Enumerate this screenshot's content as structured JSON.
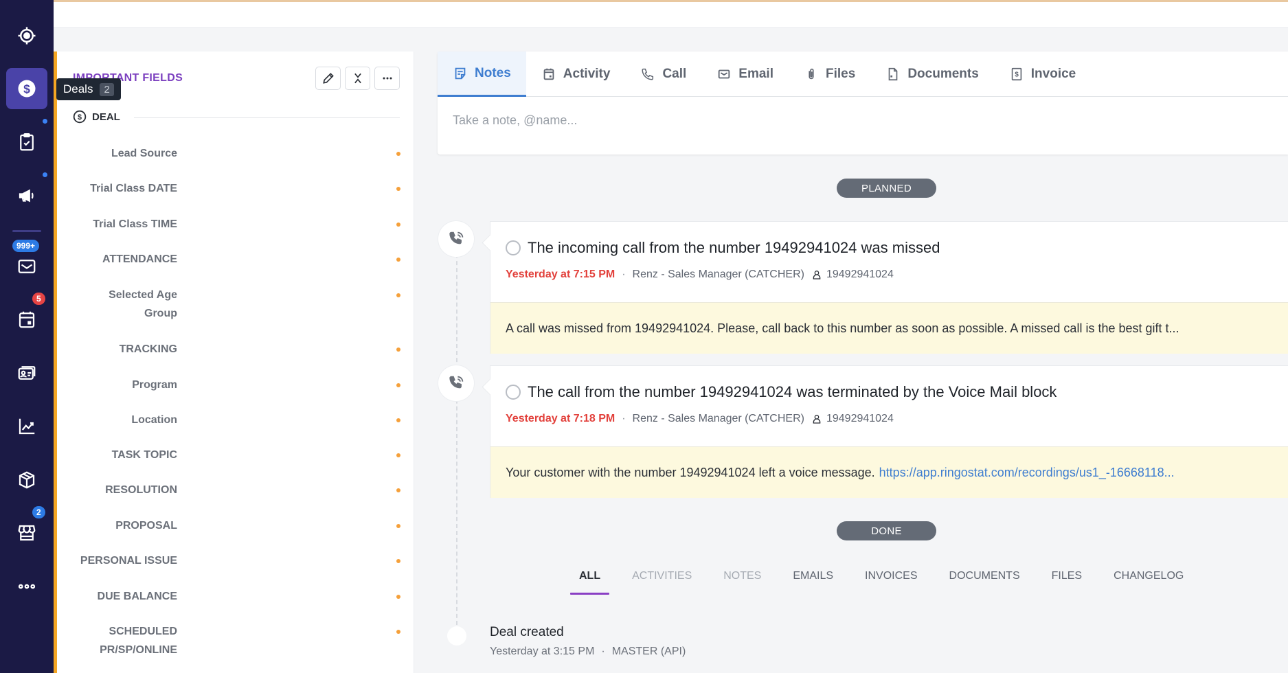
{
  "sidebar": {
    "items": [
      {
        "name": "target",
        "icon": "target-icon"
      },
      {
        "name": "deals",
        "icon": "dollar-circle-icon",
        "active": true
      },
      {
        "name": "tasks",
        "icon": "clipboard-check-icon",
        "dot": true
      },
      {
        "name": "campaigns",
        "icon": "megaphone-icon",
        "dot": true
      },
      {
        "name": "inbox",
        "icon": "envelope-icon",
        "badge": "999+"
      },
      {
        "name": "calendar",
        "icon": "calendar-icon",
        "badge": "5"
      },
      {
        "name": "contacts",
        "icon": "contact-card-icon"
      },
      {
        "name": "reports",
        "icon": "chart-line-icon"
      },
      {
        "name": "products",
        "icon": "box-icon"
      },
      {
        "name": "store",
        "icon": "storefront-icon",
        "badge": "2"
      },
      {
        "name": "more",
        "icon": "more-dots-icon"
      }
    ],
    "tooltip": {
      "label": "Deals",
      "count": "2"
    }
  },
  "left_panel": {
    "title": "IMPORTANT FIELDS",
    "section": "DEAL",
    "fields": [
      "Lead Source",
      "Trial Class DATE",
      "Trial Class TIME",
      "ATTENDANCE",
      "Selected Age Group",
      "TRACKING",
      "Program",
      "Location",
      "TASK TOPIC",
      "RESOLUTION",
      "PROPOSAL",
      "PERSONAL ISSUE",
      "DUE BALANCE",
      "SCHEDULED PR/SP/ONLINE"
    ]
  },
  "tabs": [
    {
      "label": "Notes",
      "icon": "note-icon",
      "active": true
    },
    {
      "label": "Activity",
      "icon": "calendar-icon"
    },
    {
      "label": "Call",
      "icon": "phone-icon"
    },
    {
      "label": "Email",
      "icon": "envelope-icon"
    },
    {
      "label": "Files",
      "icon": "paperclip-icon"
    },
    {
      "label": "Documents",
      "icon": "document-icon"
    },
    {
      "label": "Invoice",
      "icon": "invoice-icon"
    }
  ],
  "note_placeholder": "Take a note, @name...",
  "planned_label": "PLANNED",
  "done_label": "DONE",
  "activities": [
    {
      "title": "The incoming call from the number 19492941024 was missed",
      "time": "Yesterday at 7:15 PM",
      "owner": "Renz - Sales Manager (CATCHER)",
      "contact": "19492941024",
      "body": "A call was missed from 19492941024. Please, call back to this number as soon as possible. A missed call is the best gift t...",
      "link": ""
    },
    {
      "title": "The call from the number 19492941024 was terminated by the Voice Mail block",
      "time": "Yesterday at 7:18 PM",
      "owner": "Renz - Sales Manager (CATCHER)",
      "contact": "19492941024",
      "body": "Your customer with the number 19492941024 left a voice message.",
      "link": "https://app.ringostat.com/recordings/us1_-16668118..."
    }
  ],
  "filter_tabs": [
    {
      "label": "ALL",
      "state": "active"
    },
    {
      "label": "ACTIVITIES",
      "state": "muted"
    },
    {
      "label": "NOTES",
      "state": "muted"
    },
    {
      "label": "EMAILS",
      "state": "normal"
    },
    {
      "label": "INVOICES",
      "state": "normal"
    },
    {
      "label": "DOCUMENTS",
      "state": "normal"
    },
    {
      "label": "FILES",
      "state": "normal"
    },
    {
      "label": "CHANGELOG",
      "state": "normal"
    }
  ],
  "deal_created": {
    "title": "Deal created",
    "time": "Yesterday at 3:15 PM",
    "separator": "·",
    "by": "MASTER (API)"
  },
  "colors": {
    "sidebar_bg": "#1b1a45",
    "accent_orange": "#f5a623",
    "active_tab_blue": "#3e7dd0",
    "title_purple": "#7b3fbf",
    "time_red": "#e2403b",
    "note_yellow": "#fdf9de"
  }
}
